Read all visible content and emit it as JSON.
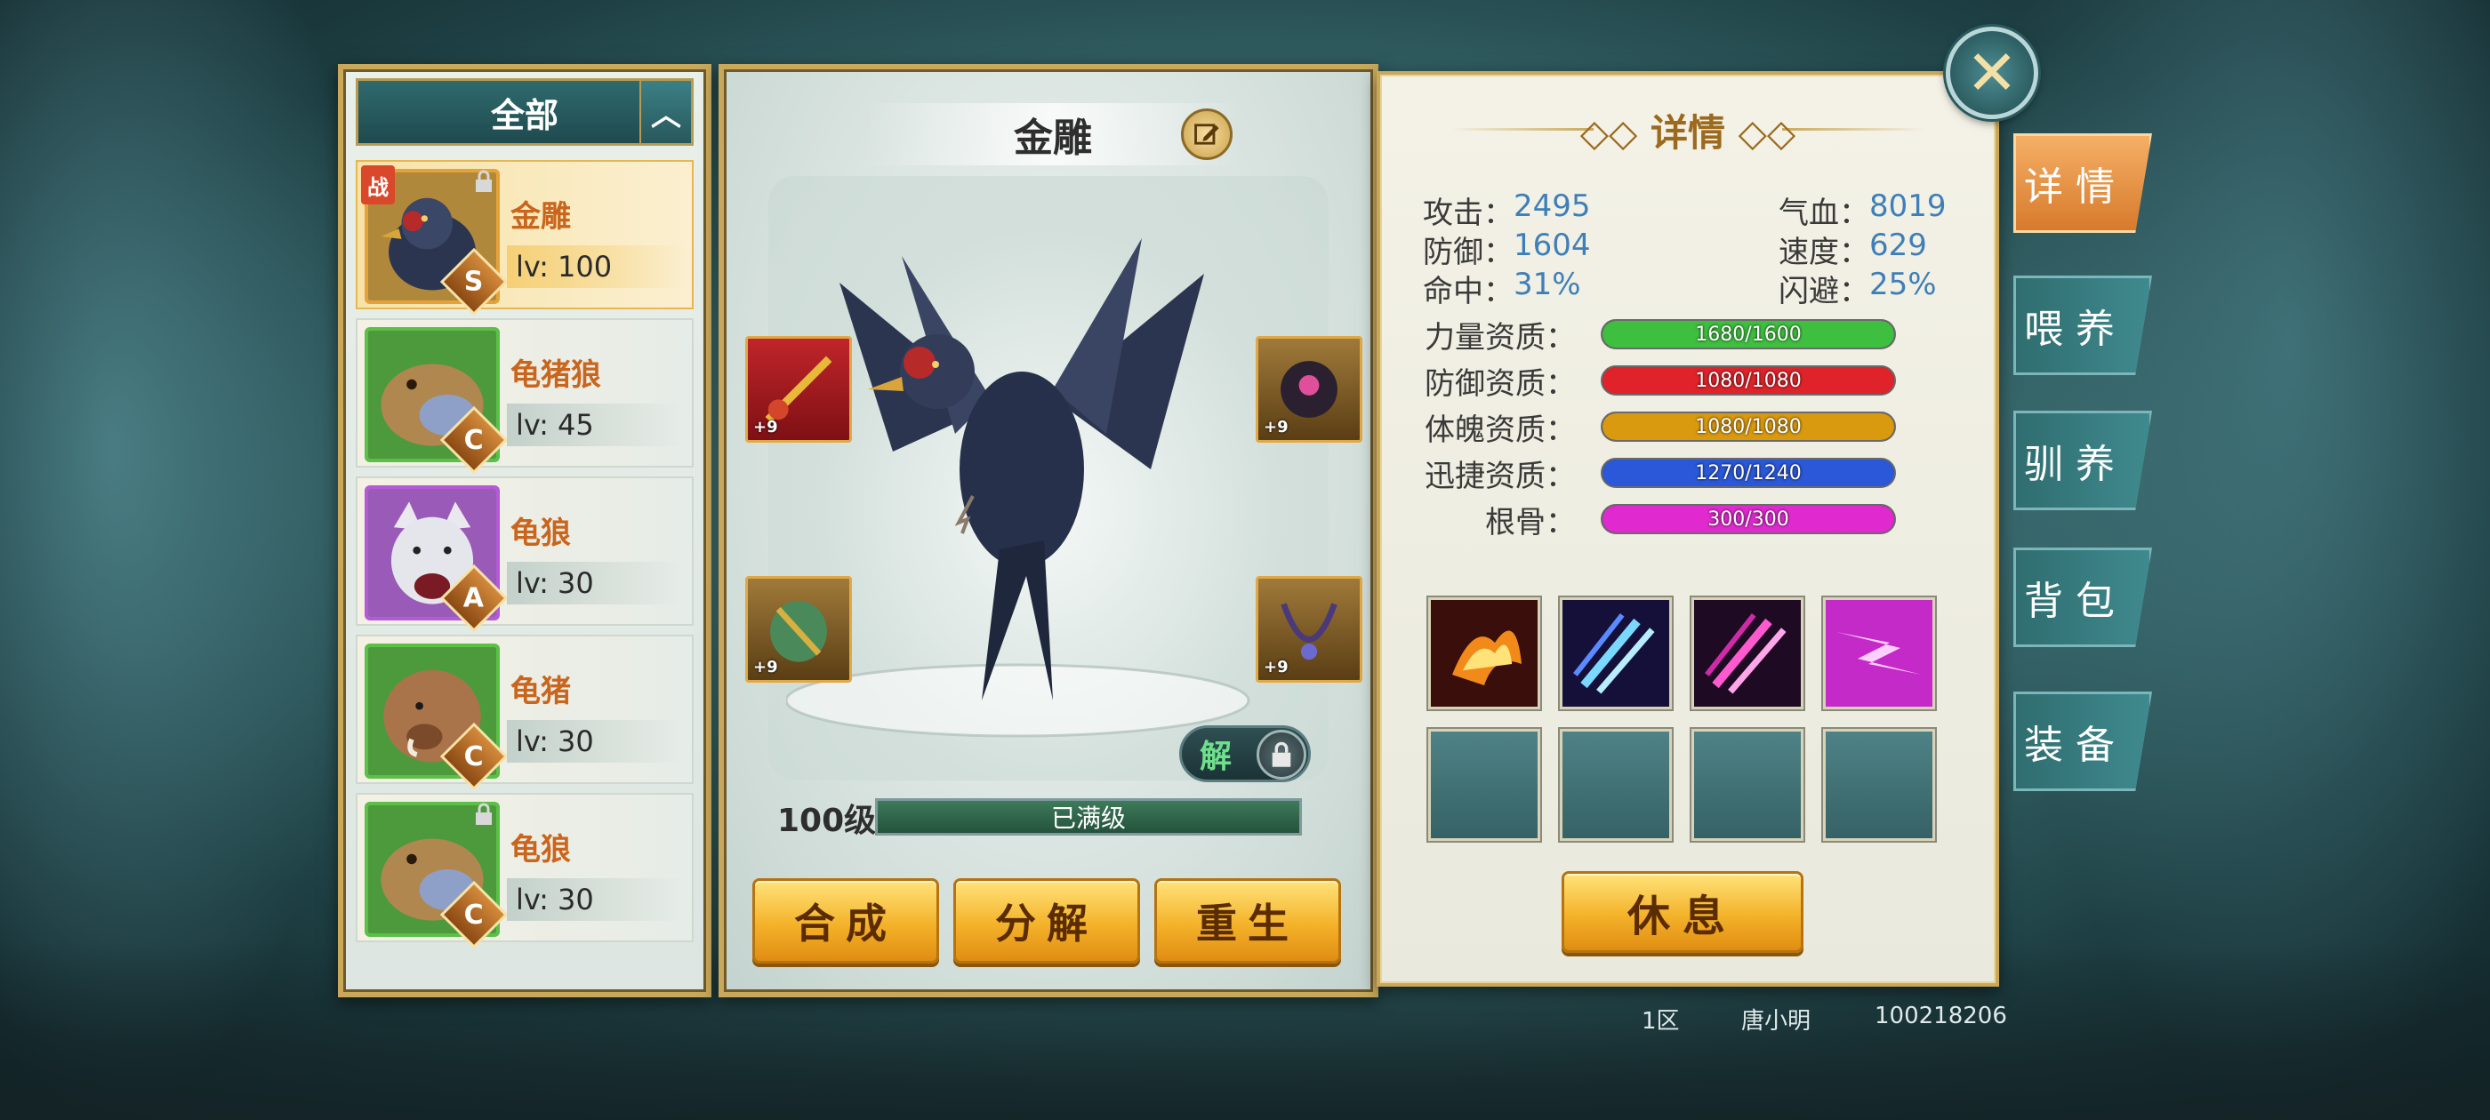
{
  "filter": {
    "label": "全部"
  },
  "pets": [
    {
      "name": "金雕",
      "level": "lv: 100",
      "grade": "S",
      "tag": "战",
      "selected": true
    },
    {
      "name": "龟猪狼",
      "level": "lv: 45",
      "grade": "C"
    },
    {
      "name": "龟狼",
      "level": "lv: 30",
      "grade": "A"
    },
    {
      "name": "龟猪",
      "level": "lv: 30",
      "grade": "C"
    },
    {
      "name": "龟狼",
      "level": "lv: 30",
      "grade": "C"
    }
  ],
  "center": {
    "pet_name": "金雕",
    "level_label": "100级",
    "exp_text": "已满级",
    "exp_progress": 1.0,
    "equip_plus": [
      "+9",
      "+9",
      "+9",
      "+9"
    ],
    "unbind_label": "解",
    "buttons": {
      "combine": "合成",
      "decompose": "分解",
      "rebirth": "重生"
    }
  },
  "detail": {
    "title": "详情",
    "stats": [
      {
        "k": "攻击：",
        "v": "2495",
        "k2": "气血：",
        "v2": "8019"
      },
      {
        "k": "防御：",
        "v": "1604",
        "k2": "速度：",
        "v2": "629"
      },
      {
        "k": "命中：",
        "v": "31%",
        "k2": "闪避：",
        "v2": "25%"
      }
    ],
    "aptitudes": [
      {
        "label": "力量资质：",
        "text": "1680/1600",
        "value": 1680,
        "max": 1600,
        "color": "#3fbf3f"
      },
      {
        "label": "防御资质：",
        "text": "1080/1080",
        "value": 1080,
        "max": 1080,
        "color": "#e0232a"
      },
      {
        "label": "体魄资质：",
        "text": "1080/1080",
        "value": 1080,
        "max": 1080,
        "color": "#d99a10"
      },
      {
        "label": "迅捷资质：",
        "text": "1270/1240",
        "value": 1270,
        "max": 1240,
        "color": "#2a58d8"
      },
      {
        "label": "根骨：",
        "text": "300/300",
        "value": 300,
        "max": 300,
        "color": "#e02ad0"
      }
    ],
    "skills": [
      "fire-phoenix-skill-icon",
      "ice-claw-skill-icon",
      "pink-claw-skill-icon",
      "magenta-slash-skill-icon"
    ],
    "rest_label": "休息"
  },
  "tabs": [
    "详情",
    "喂养",
    "驯养",
    "背包",
    "装备"
  ],
  "footer": {
    "server": "1区",
    "player": "唐小明",
    "id": "100218206"
  }
}
